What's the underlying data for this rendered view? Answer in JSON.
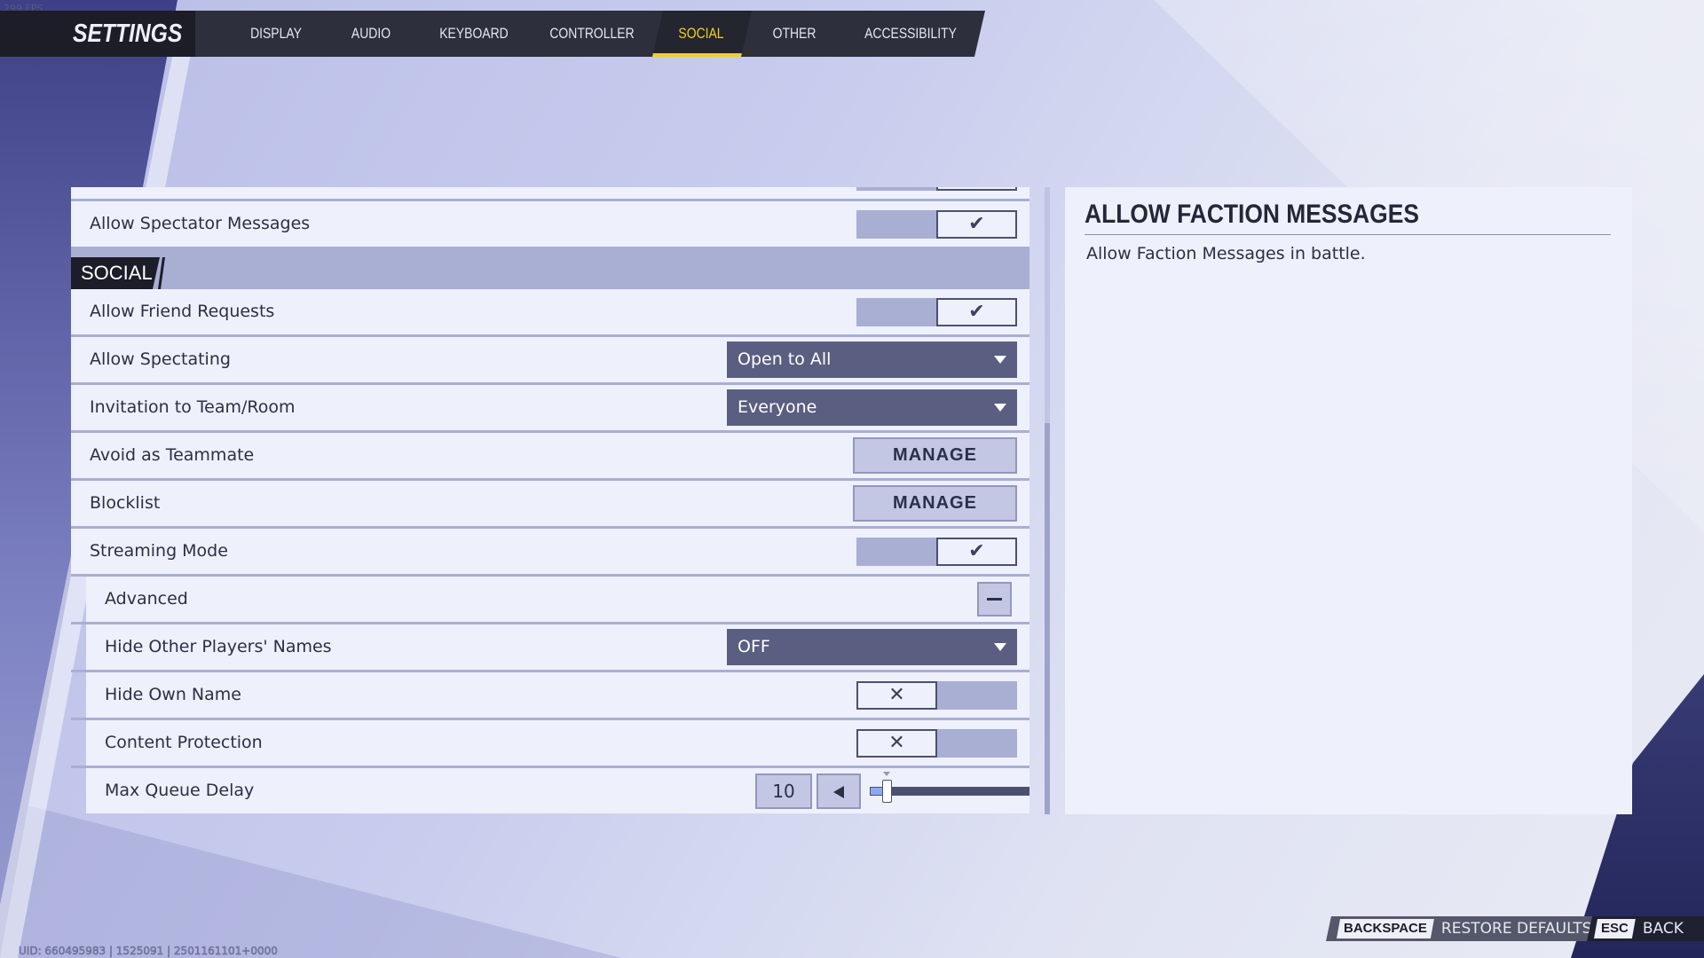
{
  "fps": "299 FPS",
  "header": {
    "title": "SETTINGS",
    "tabs": [
      {
        "label": "DISPLAY"
      },
      {
        "label": "AUDIO"
      },
      {
        "label": "KEYBOARD"
      },
      {
        "label": "CONTROLLER"
      },
      {
        "label": "SOCIAL",
        "active": true
      },
      {
        "label": "OTHER"
      },
      {
        "label": "ACCESSIBILITY"
      }
    ],
    "accent": "#f2d028"
  },
  "settings": {
    "spectator_messages": {
      "label": "Allow Spectator Messages",
      "value": true
    },
    "section": "SOCIAL",
    "friend_requests": {
      "label": "Allow Friend Requests",
      "value": true
    },
    "spectating": {
      "label": "Allow Spectating",
      "value": "Open to All"
    },
    "invitation": {
      "label": "Invitation to Team/Room",
      "value": "Everyone"
    },
    "avoid": {
      "label": "Avoid as Teammate",
      "button": "MANAGE"
    },
    "blocklist": {
      "label": "Blocklist",
      "button": "MANAGE"
    },
    "streaming": {
      "label": "Streaming Mode",
      "value": true
    },
    "advanced": {
      "label": "Advanced",
      "expanded": true
    },
    "hide_names": {
      "label": "Hide Other Players' Names",
      "value": "OFF"
    },
    "hide_own": {
      "label": "Hide Own Name",
      "value": false
    },
    "content_protection": {
      "label": "Content Protection",
      "value": false
    },
    "queue_delay": {
      "label": "Max Queue Delay",
      "value": "10",
      "fraction": 0.1
    },
    "check_glyph": "✔",
    "cross_glyph": "✕"
  },
  "info": {
    "title": "ALLOW FACTION MESSAGES",
    "description": "Allow Faction Messages in battle."
  },
  "footer": {
    "restore_key": "BACKSPACE",
    "restore_label": "RESTORE DEFAULTS",
    "back_key": "ESC",
    "back_label": "BACK",
    "uid": "UID: 660495983 | 1525091 | 2501161101+0000"
  }
}
